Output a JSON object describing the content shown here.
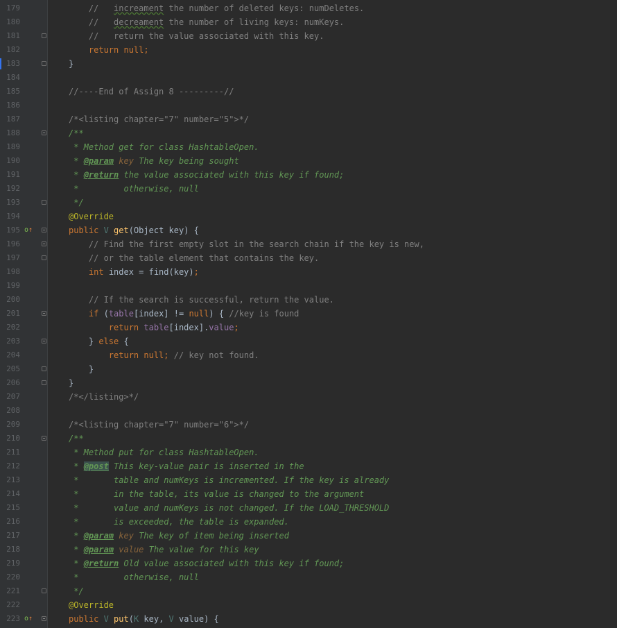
{
  "editor": {
    "lines": [
      {
        "n": "179",
        "segs": [
          {
            "t": "    //   ",
            "c": "cm"
          },
          {
            "t": "increament",
            "c": "cm sq"
          },
          {
            "t": " the number of deleted keys: numDeletes.",
            "c": "cm"
          }
        ]
      },
      {
        "n": "180",
        "segs": [
          {
            "t": "    //   ",
            "c": "cm"
          },
          {
            "t": "decreament",
            "c": "cm sq"
          },
          {
            "t": " the number of living keys: numKeys.",
            "c": "cm"
          }
        ]
      },
      {
        "n": "181",
        "fold": "close",
        "segs": [
          {
            "t": "    //   return the value associated with this key.",
            "c": "cm"
          }
        ]
      },
      {
        "n": "182",
        "segs": [
          {
            "t": "    ",
            "c": ""
          },
          {
            "t": "return null",
            "c": "kw"
          },
          {
            "t": ";",
            "c": "kw"
          }
        ]
      },
      {
        "n": "183",
        "fold": "close",
        "caret": true,
        "segs": [
          {
            "t": "}",
            "c": ""
          }
        ]
      },
      {
        "n": "184",
        "segs": []
      },
      {
        "n": "185",
        "segs": [
          {
            "t": "//----End of Assign 8 ---------//",
            "c": "cm"
          }
        ]
      },
      {
        "n": "186",
        "segs": []
      },
      {
        "n": "187",
        "segs": [
          {
            "t": "/*<listing chapter=\"7\" number=\"5\">*/",
            "c": "cm"
          }
        ]
      },
      {
        "n": "188",
        "fold": "open",
        "segs": [
          {
            "t": "/**",
            "c": "dc"
          }
        ]
      },
      {
        "n": "189",
        "segs": [
          {
            "t": " * Method get for class HashtableOpen.",
            "c": "dc"
          }
        ]
      },
      {
        "n": "190",
        "segs": [
          {
            "t": " * ",
            "c": "dc"
          },
          {
            "t": "@param",
            "c": "dtag"
          },
          {
            "t": " ",
            "c": "dc"
          },
          {
            "t": "key",
            "c": "dparam"
          },
          {
            "t": " The key being sought",
            "c": "dc"
          }
        ]
      },
      {
        "n": "191",
        "segs": [
          {
            "t": " * ",
            "c": "dc"
          },
          {
            "t": "@return",
            "c": "dtag"
          },
          {
            "t": " the value associated with this key if found;",
            "c": "dc"
          }
        ]
      },
      {
        "n": "192",
        "segs": [
          {
            "t": " *         otherwise, null",
            "c": "dc"
          }
        ]
      },
      {
        "n": "193",
        "fold": "close",
        "segs": [
          {
            "t": " */",
            "c": "dc"
          }
        ]
      },
      {
        "n": "194",
        "segs": [
          {
            "t": "@Override",
            "c": "an"
          }
        ]
      },
      {
        "n": "195",
        "marker": "override",
        "fold": "open",
        "segs": [
          {
            "t": "public ",
            "c": "kw"
          },
          {
            "t": "V ",
            "c": "tp"
          },
          {
            "t": "get",
            "c": "fn"
          },
          {
            "t": "(Object key) {",
            "c": ""
          }
        ]
      },
      {
        "n": "196",
        "fold": "open",
        "segs": [
          {
            "t": "    // Find the first empty slot in the search chain if the key is new,",
            "c": "cm"
          }
        ]
      },
      {
        "n": "197",
        "fold": "close",
        "segs": [
          {
            "t": "    // or the table element that contains the key.",
            "c": "cm"
          }
        ]
      },
      {
        "n": "198",
        "segs": [
          {
            "t": "    ",
            "c": ""
          },
          {
            "t": "int ",
            "c": "kw"
          },
          {
            "t": "index = find(key)",
            "c": ""
          },
          {
            "t": ";",
            "c": "kw"
          }
        ]
      },
      {
        "n": "199",
        "segs": []
      },
      {
        "n": "200",
        "segs": [
          {
            "t": "    // If the search is successful, return the value.",
            "c": "cm"
          }
        ]
      },
      {
        "n": "201",
        "fold": "open",
        "segs": [
          {
            "t": "    ",
            "c": ""
          },
          {
            "t": "if ",
            "c": "kw"
          },
          {
            "t": "(",
            "c": ""
          },
          {
            "t": "table",
            "c": "fld"
          },
          {
            "t": "[index] != ",
            "c": ""
          },
          {
            "t": "null",
            "c": "kw"
          },
          {
            "t": ") { ",
            "c": ""
          },
          {
            "t": "//key is found",
            "c": "cm"
          }
        ]
      },
      {
        "n": "202",
        "segs": [
          {
            "t": "        ",
            "c": ""
          },
          {
            "t": "return ",
            "c": "kw"
          },
          {
            "t": "table",
            "c": "fld"
          },
          {
            "t": "[index].",
            "c": ""
          },
          {
            "t": "value",
            "c": "fld"
          },
          {
            "t": ";",
            "c": "kw"
          }
        ]
      },
      {
        "n": "203",
        "fold": "open",
        "segs": [
          {
            "t": "    } ",
            "c": ""
          },
          {
            "t": "else ",
            "c": "kw"
          },
          {
            "t": "{",
            "c": ""
          }
        ]
      },
      {
        "n": "204",
        "segs": [
          {
            "t": "        ",
            "c": ""
          },
          {
            "t": "return null",
            "c": "kw"
          },
          {
            "t": "; ",
            "c": "kw"
          },
          {
            "t": "// key not found.",
            "c": "cm"
          }
        ]
      },
      {
        "n": "205",
        "fold": "close",
        "segs": [
          {
            "t": "    }",
            "c": ""
          }
        ]
      },
      {
        "n": "206",
        "fold": "close",
        "segs": [
          {
            "t": "}",
            "c": ""
          }
        ]
      },
      {
        "n": "207",
        "segs": [
          {
            "t": "/*</listing>*/",
            "c": "cm"
          }
        ]
      },
      {
        "n": "208",
        "segs": []
      },
      {
        "n": "209",
        "segs": [
          {
            "t": "/*<listing chapter=\"7\" number=\"6\">*/",
            "c": "cm"
          }
        ]
      },
      {
        "n": "210",
        "fold": "open",
        "segs": [
          {
            "t": "/**",
            "c": "dc"
          }
        ]
      },
      {
        "n": "211",
        "segs": [
          {
            "t": " * Method put for class HashtableOpen.",
            "c": "dc"
          }
        ]
      },
      {
        "n": "212",
        "segs": [
          {
            "t": " * ",
            "c": "dc"
          },
          {
            "t": "@post",
            "c": "dtag hl"
          },
          {
            "t": " This key-value pair is inserted in the",
            "c": "dc"
          }
        ]
      },
      {
        "n": "213",
        "segs": [
          {
            "t": " *       table and numKeys is incremented. If the key is already",
            "c": "dc"
          }
        ]
      },
      {
        "n": "214",
        "segs": [
          {
            "t": " *       in the table, its value is changed to the argument",
            "c": "dc"
          }
        ]
      },
      {
        "n": "215",
        "segs": [
          {
            "t": " *       value and numKeys is not changed. If the LOAD_THRESHOLD",
            "c": "dc"
          }
        ]
      },
      {
        "n": "216",
        "segs": [
          {
            "t": " *       is exceeded, the table is expanded.",
            "c": "dc"
          }
        ]
      },
      {
        "n": "217",
        "segs": [
          {
            "t": " * ",
            "c": "dc"
          },
          {
            "t": "@param",
            "c": "dtag"
          },
          {
            "t": " ",
            "c": "dc"
          },
          {
            "t": "key",
            "c": "dparam"
          },
          {
            "t": " The key of item being inserted",
            "c": "dc"
          }
        ]
      },
      {
        "n": "218",
        "segs": [
          {
            "t": " * ",
            "c": "dc"
          },
          {
            "t": "@param",
            "c": "dtag"
          },
          {
            "t": " ",
            "c": "dc"
          },
          {
            "t": "value",
            "c": "dparam"
          },
          {
            "t": " The value for this key",
            "c": "dc"
          }
        ]
      },
      {
        "n": "219",
        "segs": [
          {
            "t": " * ",
            "c": "dc"
          },
          {
            "t": "@return",
            "c": "dtag"
          },
          {
            "t": " Old value associated with this key if found;",
            "c": "dc"
          }
        ]
      },
      {
        "n": "220",
        "segs": [
          {
            "t": " *         otherwise, null",
            "c": "dc"
          }
        ]
      },
      {
        "n": "221",
        "fold": "close",
        "segs": [
          {
            "t": " */",
            "c": "dc"
          }
        ]
      },
      {
        "n": "222",
        "segs": [
          {
            "t": "@Override",
            "c": "an"
          }
        ]
      },
      {
        "n": "223",
        "marker": "override",
        "fold": "open",
        "segs": [
          {
            "t": "public ",
            "c": "kw"
          },
          {
            "t": "V ",
            "c": "tp"
          },
          {
            "t": "put",
            "c": "fn"
          },
          {
            "t": "(",
            "c": ""
          },
          {
            "t": "K ",
            "c": "tp"
          },
          {
            "t": "key, ",
            "c": ""
          },
          {
            "t": "V ",
            "c": "tp"
          },
          {
            "t": "value) {",
            "c": ""
          }
        ]
      }
    ]
  }
}
